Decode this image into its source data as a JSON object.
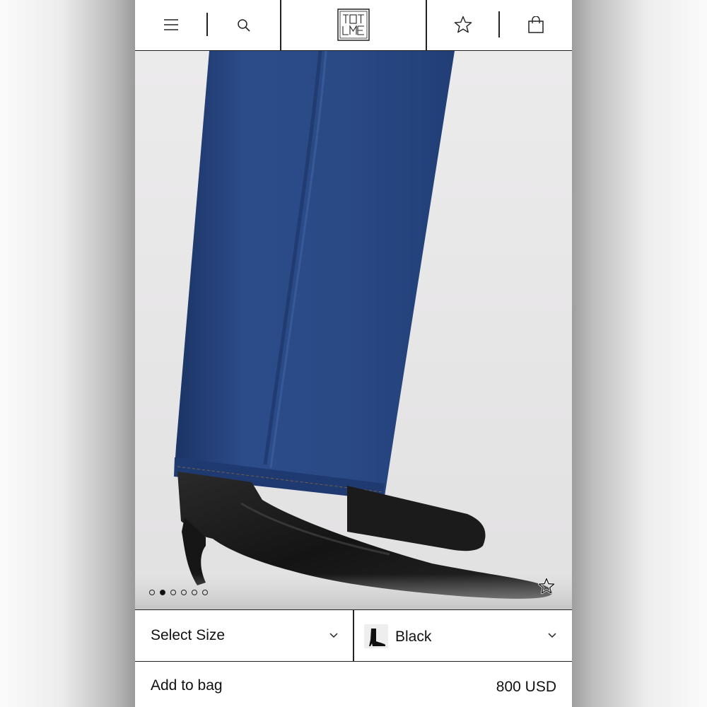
{
  "header": {
    "menu_icon": "hamburger-icon",
    "search_icon": "search-icon",
    "logo": "TOTEME",
    "wishlist_icon": "star-icon",
    "bag_icon": "shopping-bag-icon"
  },
  "gallery": {
    "image": "product-photo-boots-and-jeans",
    "slide_count": 6,
    "active_slide": 2,
    "favorite_icon": "star-outline-icon"
  },
  "product": {
    "size_label": "Select Size",
    "color_label": "Black",
    "color_swatch": "boot-thumbnail",
    "add_to_bag_label": "Add to bag",
    "price": "800 USD"
  },
  "colors": {
    "denim": "#2a4a84",
    "denim_dark": "#1f3a6e",
    "leather": "#1c1c1c",
    "background": "#e9e8e9"
  }
}
